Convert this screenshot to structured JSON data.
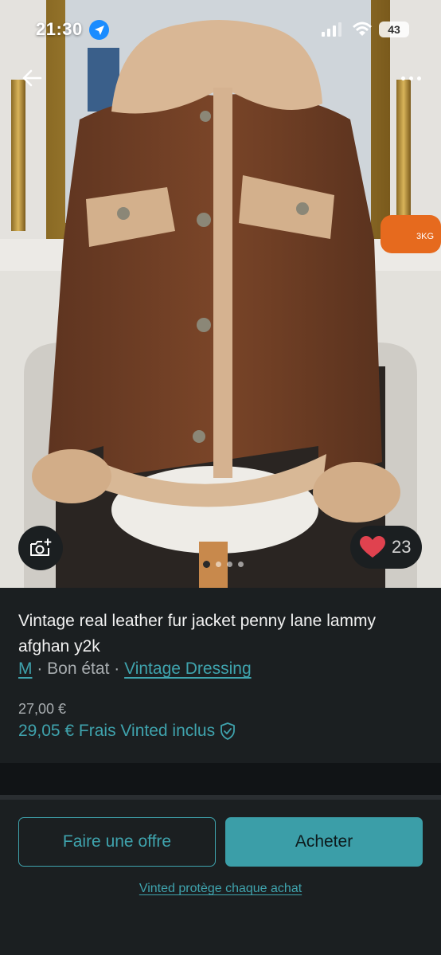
{
  "status_bar": {
    "time": "21:30",
    "battery": "43",
    "location_icon": "location-arrow-icon",
    "signal_icon": "cellular-signal-icon",
    "wifi_icon": "wifi-icon"
  },
  "photo": {
    "back_icon": "back-arrow-icon",
    "more_icon": "more-horizontal-icon",
    "camera_icon": "camera-plus-icon",
    "favorite_icon": "heart-icon",
    "favorite_count": "23",
    "carousel_pages": 4,
    "carousel_active": 1,
    "dumbbell_label": "3KG"
  },
  "item": {
    "title": "Vintage real leather fur jacket penny lane lammy afghan y2k",
    "size": "M",
    "separator_1": " · ",
    "condition": "Bon état",
    "separator_2": " · ",
    "brand": "Vintage Dressing",
    "price": "27,00 €",
    "price_incl": "29,05 € Frais Vinted inclus",
    "shield_icon": "shield-check-icon"
  },
  "actions": {
    "offer_label": "Faire une offre",
    "buy_label": "Acheter",
    "protection_link": "Vinted protège chaque achat"
  },
  "colors": {
    "accent": "#3fa3ad",
    "background": "#1b1f21",
    "heart": "#e0424f"
  }
}
